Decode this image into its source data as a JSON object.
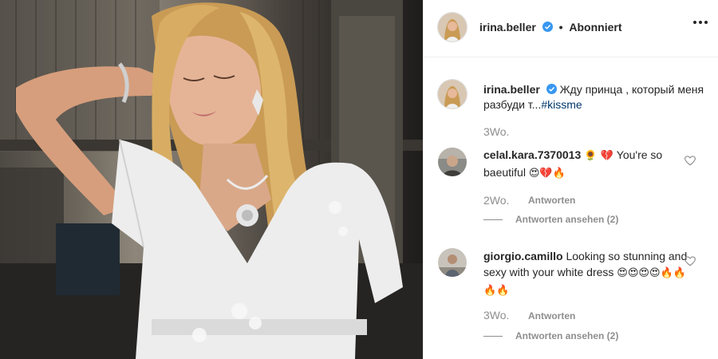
{
  "post": {
    "author": "irina.beller",
    "follow_status": "Abonniert",
    "verified": true
  },
  "caption": {
    "author": "irina.beller",
    "text": "Жду принца , который меня разбуди т...",
    "hashtag": "#kissme",
    "time": "3Wo."
  },
  "comments": [
    {
      "author": "celal.kara.7370013",
      "text_prefix": "🌻 💔 ",
      "text": "You're so baeutiful ",
      "text_suffix": "😍💔🔥",
      "time": "2Wo.",
      "reply_label": "Antworten",
      "view_replies": "Antworten ansehen (2)"
    },
    {
      "author": "giorgio.camillo",
      "text_prefix": "",
      "text": "Looking so stunning and sexy with your white dress ",
      "text_suffix": "😍😍😍😍🔥🔥🔥🔥",
      "time": "3Wo.",
      "reply_label": "Antworten",
      "view_replies": "Antworten ansehen (2)"
    }
  ],
  "colors": {
    "username": "#262626",
    "muted": "#8e8e8e",
    "hashtag": "#00376b",
    "verified_badge": "#3897f0",
    "divider": "#efefef"
  },
  "icons": {
    "more": "more-options-icon",
    "like": "heart-icon",
    "verified": "verified-badge-icon"
  }
}
